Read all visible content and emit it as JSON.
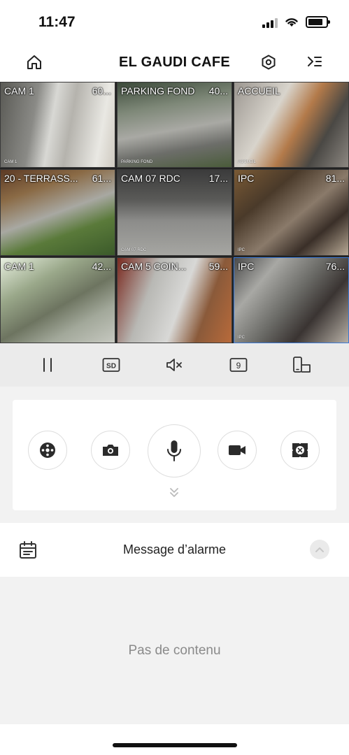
{
  "status_bar": {
    "time": "11:47"
  },
  "header": {
    "title": "EL GAUDI CAFE",
    "left_icon": "home-icon",
    "right_icons": [
      "hexagon-settings-icon",
      "device-list-icon"
    ]
  },
  "cameras": [
    {
      "label": "CAM 1",
      "number": "60...",
      "osd": "CAM 1"
    },
    {
      "label": "PARKING FOND",
      "number": "40...",
      "osd": "PARKING FOND"
    },
    {
      "label": "ACCUEIL",
      "number": "",
      "osd": "ACCUEIL"
    },
    {
      "label": "20 - TERRASS...",
      "number": "61...",
      "osd": ""
    },
    {
      "label": "CAM 07 RDC",
      "number": "17...",
      "osd": "CAM 07 RDC"
    },
    {
      "label": "IPC",
      "number": "81...",
      "osd": "IPC"
    },
    {
      "label": "CAM 1",
      "number": "42...",
      "osd": ""
    },
    {
      "label": "CAM 5 COIN...",
      "number": "59...",
      "osd": ""
    },
    {
      "label": "IPC",
      "number": "76...",
      "osd": "IPC"
    }
  ],
  "controls": {
    "pause_icon": "pause-icon",
    "quality_label": "SD",
    "mute_icon": "speaker-muted-icon",
    "split_label": "9",
    "device_icon": "screen-rotate-icon"
  },
  "actions": [
    "ptz-control-icon",
    "camera-snapshot-icon",
    "microphone-icon",
    "video-record-icon",
    "fisheye-icon"
  ],
  "alarm": {
    "title": "Message d’alarme"
  },
  "empty_state": "Pas de contenu",
  "colors": {
    "accent": "#3a78d6",
    "panel_bg": "#ebebeb",
    "page_bg": "#f2f2f2"
  }
}
